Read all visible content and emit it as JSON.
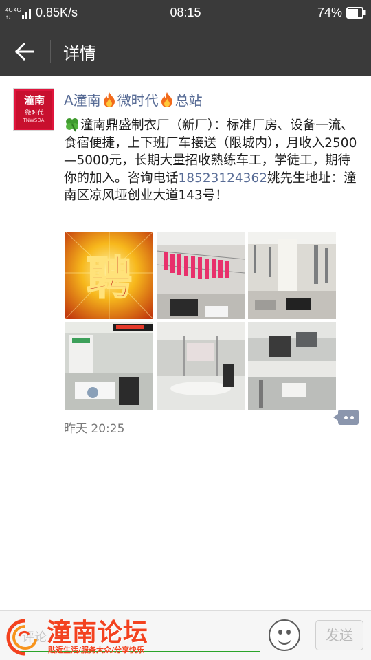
{
  "status_bar": {
    "network_speed": "0.85K/s",
    "time": "08:15",
    "battery_percent": "74%",
    "signal_label": "4G 4G"
  },
  "app_bar": {
    "title": "详情"
  },
  "post": {
    "avatar": {
      "line1": "潼南",
      "line2": "微时代",
      "line3": "TNWSDAI"
    },
    "author": {
      "part1": "A潼南",
      "part2": "微时代",
      "part3": "总站"
    },
    "text_main": "潼南鼎盛制衣厂（新厂）：标准厂房、设备一流、食宿便捷，上下班厂车接送（限城内），月收入2500—5000元，长期大量招收熟练车工，学徒工，期待你的加入。咨询电话",
    "phone": "18523124362",
    "text_after": "姚先生地址：潼南区凉风垭创业大道143号！",
    "photos": [
      {
        "label": "聘",
        "desc": "recruit"
      },
      {
        "desc": "workshop-1"
      },
      {
        "desc": "workshop-2"
      },
      {
        "desc": "workshop-3"
      },
      {
        "desc": "workshop-4"
      },
      {
        "desc": "workshop-5"
      }
    ],
    "time": "昨天 20:25"
  },
  "bottom_bar": {
    "comment_placeholder": "评论",
    "forum_name": "潼南论坛",
    "forum_slogan": "贴近生活/服务大众/分享快乐",
    "send_label": "发送"
  },
  "colors": {
    "bar_bg": "#3a3a3a",
    "link": "#576b95",
    "forum_red": "#f3421f",
    "input_underline": "#2aa52a"
  }
}
